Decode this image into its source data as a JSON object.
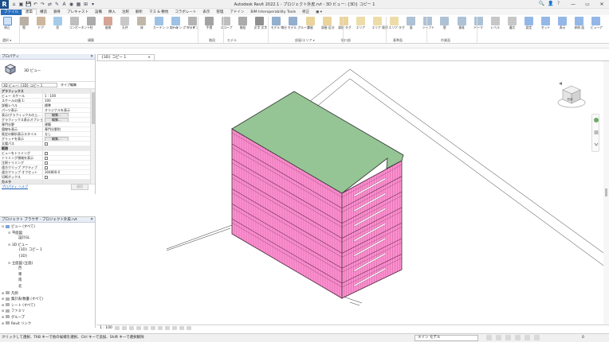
{
  "app": {
    "title": "Autodesk Revit 2022.1 - プロジェクト外皮.rvt - 3D ビュー: {3D} コピー 1",
    "quick_access": [
      "⌂",
      "▣",
      "💾",
      "↶",
      "↷",
      "⇄",
      "✎",
      "A",
      "◉",
      "▦",
      "⊞",
      "▾"
    ],
    "help_items": [
      "🔍",
      "👤",
      "?"
    ],
    "window_buttons": [
      "—",
      "▭",
      "✕"
    ]
  },
  "ribbon_tabs": [
    "ファイル",
    "建築",
    "構造",
    "鉄骨",
    "プレキャスト",
    "設備",
    "挿入",
    "注釈",
    "解析",
    "マス & 敷地",
    "コラボレート",
    "表示",
    "管理",
    "アドイン",
    "BIM Interoperability Tools",
    "修正",
    "▣ ▾"
  ],
  "ribbon": {
    "buttons": [
      {
        "label": "修正",
        "icon": "modify-icon"
      },
      {
        "label": "壁",
        "icon": "wall-icon"
      },
      {
        "label": "ドア",
        "icon": "door-icon"
      },
      {
        "label": "窓",
        "icon": "window-icon"
      },
      {
        "label": "コンポーネント",
        "icon": "component-icon"
      },
      {
        "label": "柱",
        "icon": "column-icon"
      },
      {
        "label": "屋根",
        "icon": "roof-icon"
      },
      {
        "label": "天井",
        "icon": "ceiling-icon"
      },
      {
        "label": "床",
        "icon": "floor-icon"
      },
      {
        "label": "カーテン システム",
        "icon": "curtain-system-icon"
      },
      {
        "label": "カーテン グリッド",
        "icon": "curtain-grid-icon"
      },
      {
        "label": "マリオン",
        "icon": "mullion-icon"
      },
      {
        "label": "手摺",
        "icon": "railing-icon"
      },
      {
        "label": "スロープ",
        "icon": "ramp-icon"
      },
      {
        "label": "階段",
        "icon": "stair-icon"
      },
      {
        "label": "文字 文字",
        "icon": "text-icon"
      },
      {
        "label": "モデル 線分",
        "icon": "model-line-icon"
      },
      {
        "label": "モデル グループ",
        "icon": "model-group-icon"
      },
      {
        "label": "部屋",
        "icon": "room-icon"
      },
      {
        "label": "部屋 区分",
        "icon": "room-separator-icon"
      },
      {
        "label": "部屋 タグ",
        "icon": "room-tag-icon"
      },
      {
        "label": "エリア",
        "icon": "area-icon"
      },
      {
        "label": "エリア 境界",
        "icon": "area-boundary-icon"
      },
      {
        "label": "エリア タグ",
        "icon": "area-tag-icon"
      },
      {
        "label": "面",
        "icon": "by-face-icon"
      },
      {
        "label": "シャフト",
        "icon": "shaft-icon"
      },
      {
        "label": "壁",
        "icon": "wall-opening-icon"
      },
      {
        "label": "垂直",
        "icon": "vertical-icon"
      },
      {
        "label": "ドーマ",
        "icon": "dormer-icon"
      },
      {
        "label": "レベル",
        "icon": "level-icon"
      },
      {
        "label": "通芯",
        "icon": "grid-icon"
      },
      {
        "label": "設定",
        "icon": "set-icon"
      },
      {
        "label": "セット",
        "icon": "show-icon"
      },
      {
        "label": "表示",
        "icon": "ref-plane-icon"
      },
      {
        "label": "参照 面",
        "icon": "viewer-icon"
      },
      {
        "label": "ビューア",
        "icon": "viewer-icon"
      }
    ],
    "panels": [
      "選択 ▾",
      "構築",
      "階段",
      "モデル",
      "部屋/エリア ▾",
      "開口部",
      "基準面",
      "作業面"
    ]
  },
  "properties": {
    "title": "プロパティ",
    "type_name": "3D ビュー",
    "instance_selector": "3D ビュー: {3D} コピー 1",
    "edit_type": "タイプ編集",
    "rows": [
      {
        "k": "グラフィックス",
        "v": "",
        "sec": true
      },
      {
        "k": "ビュー スケール",
        "v": "1 : 100"
      },
      {
        "k": "スケールの値    1:",
        "v": "100"
      },
      {
        "k": "詳細レベル",
        "v": "標準"
      },
      {
        "k": "パーツ表示",
        "v": "オリジナルを表示"
      },
      {
        "k": "表示/グラフィックスの上...",
        "v": "編集...",
        "btn": true
      },
      {
        "k": "グラフィックス表示オプション",
        "v": "編集...",
        "btn": true
      },
      {
        "k": "専門分野",
        "v": "建築"
      },
      {
        "k": "隠線を表示",
        "v": "専門分野別"
      },
      {
        "k": "既定の解析表示スタイル",
        "v": "なし"
      },
      {
        "k": "グリッドを表示",
        "v": "編集...",
        "btn": true
      },
      {
        "k": "太陽パス",
        "v": "",
        "cb": true
      },
      {
        "k": "範囲",
        "v": "",
        "sec": true
      },
      {
        "k": "ビューをトリミング",
        "v": "",
        "cb": true
      },
      {
        "k": "トリミング領域を表示",
        "v": "",
        "cb": true
      },
      {
        "k": "注釈トリミング",
        "v": "",
        "cb": true
      },
      {
        "k": "遠方クリップ アクティブ",
        "v": "",
        "cb": true
      },
      {
        "k": "遠方クリップ オフセット",
        "v": "304800.0"
      },
      {
        "k": "切断ボックス",
        "v": "",
        "cb": true
      },
      {
        "k": "カメラ",
        "v": "",
        "sec": true
      }
    ],
    "help_link": "プロパティ ヘルプ",
    "apply": "適用"
  },
  "browser": {
    "title": "プロジェクト ブラウザ - プロジェクト外皮.rvt",
    "nodes": [
      {
        "label": "ビュー (すべて)",
        "d": 0,
        "exp": "⊟",
        "icon": true
      },
      {
        "label": "平面図",
        "d": 1,
        "exp": "⊟"
      },
      {
        "label": "設計GL",
        "d": 2,
        "exp": ""
      },
      {
        "label": "3D ビュー",
        "d": 1,
        "exp": "⊟"
      },
      {
        "label": "{3D} コピー 1",
        "d": 2,
        "exp": ""
      },
      {
        "label": "{3D}",
        "d": 2,
        "exp": ""
      },
      {
        "label": "立面図 (立面)",
        "d": 1,
        "exp": "⊟"
      },
      {
        "label": "西",
        "d": 2,
        "exp": ""
      },
      {
        "label": "東",
        "d": 2,
        "exp": ""
      },
      {
        "label": "南",
        "d": 2,
        "exp": ""
      },
      {
        "label": "北",
        "d": 2,
        "exp": ""
      },
      {
        "label": "凡例",
        "d": 0,
        "exp": "⊞",
        "icon": true
      },
      {
        "label": "集計表/数量 (すべて)",
        "d": 0,
        "exp": "⊞",
        "icon": true
      },
      {
        "label": "シート (すべて)",
        "d": 0,
        "exp": "⊞",
        "icon": true
      },
      {
        "label": "ファミリ",
        "d": 0,
        "exp": "⊞",
        "icon": true
      },
      {
        "label": "グループ",
        "d": 0,
        "exp": "⊞",
        "icon": true
      },
      {
        "label": "Revit リンク",
        "d": 0,
        "exp": "⊞",
        "icon": true
      }
    ]
  },
  "view_tab": {
    "label": "{3D} コピー 1",
    "close": "×"
  },
  "viewcube": {
    "face": "前面"
  },
  "view_control": {
    "scale": "1 : 100"
  },
  "status": {
    "text": "クリックして選択、TAB キーで他の候補を選択、Ctrl キーで追加、Shift キーで選択解除",
    "model": "メイン モデル",
    "count": "0"
  },
  "colors": {
    "roof": "#95c594",
    "facade": "#ff8fd0",
    "accent": "#2a6ebd"
  }
}
